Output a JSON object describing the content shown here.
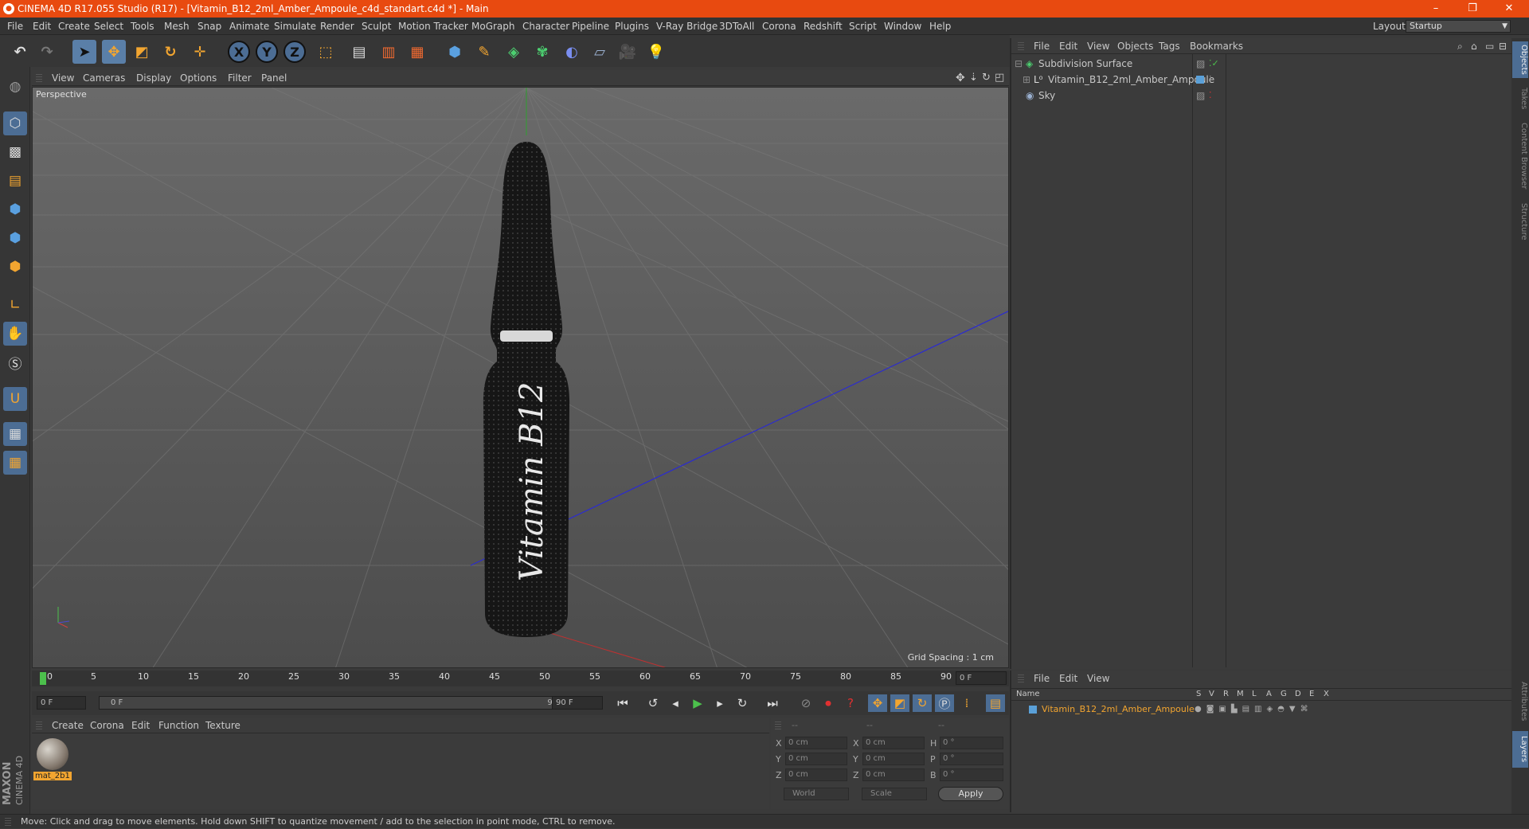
{
  "title": {
    "text": "CINEMA 4D R17.055 Studio (R17) - [Vitamin_B12_2ml_Amber_Ampoule_c4d_standart.c4d *] - Main",
    "minimize": "–",
    "restore": "❐",
    "close": "✕"
  },
  "menu": {
    "items": [
      "File",
      "Edit",
      "Create",
      "Select",
      "Tools",
      "Mesh",
      "Snap",
      "Animate",
      "Simulate",
      "Render",
      "Sculpt",
      "Motion Tracker",
      "MoGraph",
      "Character",
      "Pipeline",
      "Plugins",
      "V-Ray Bridge",
      "3DToAll",
      "Corona",
      "Redshift",
      "Script",
      "Window",
      "Help"
    ],
    "layout_label": "Layout:",
    "layout_value": "Startup"
  },
  "toolbar": {
    "axis_x": "X",
    "axis_y": "Y",
    "axis_z": "Z"
  },
  "viewport": {
    "menu": [
      "View",
      "Cameras",
      "Display",
      "Options",
      "Filter",
      "Panel"
    ],
    "label": "Perspective",
    "grid_spacing": "Grid Spacing : 1 cm",
    "bottle_text": "Vitamin B12"
  },
  "timeline": {
    "ticks": [
      "0",
      "5",
      "10",
      "15",
      "20",
      "25",
      "30",
      "35",
      "40",
      "45",
      "50",
      "55",
      "60",
      "65",
      "70",
      "75",
      "80",
      "85",
      "90"
    ],
    "current_frame": "0 F",
    "start_frame": "0 F",
    "range_start": "0 F",
    "range_end": "90 F",
    "end_frame": "90 F"
  },
  "material_manager": {
    "menu": [
      "Create",
      "Corona",
      "Edit",
      "Function",
      "Texture"
    ],
    "material_name": "mat_2b1"
  },
  "coordinates": {
    "headers": [
      "--",
      "--",
      "--"
    ],
    "rows": [
      {
        "a": "X",
        "av": "0 cm",
        "b": "X",
        "bv": "0 cm",
        "c": "H",
        "cv": "0 °"
      },
      {
        "a": "Y",
        "av": "0 cm",
        "b": "Y",
        "bv": "0 cm",
        "c": "P",
        "cv": "0 °"
      },
      {
        "a": "Z",
        "av": "0 cm",
        "b": "Z",
        "bv": "0 cm",
        "c": "B",
        "cv": "0 °"
      }
    ],
    "mode": "World",
    "size_mode": "Scale",
    "apply": "Apply"
  },
  "objects_panel": {
    "menu": [
      "File",
      "Edit",
      "View",
      "Objects",
      "Tags",
      "Bookmarks"
    ],
    "objects": [
      {
        "name": "Subdivision Surface",
        "indent": 0
      },
      {
        "name": "Vitamin_B12_2ml_Amber_Ampoule",
        "indent": 1
      },
      {
        "name": "Sky",
        "indent": 0
      }
    ]
  },
  "layers_panel": {
    "menu": [
      "File",
      "Edit",
      "View"
    ],
    "columns": [
      "Name",
      "S",
      "V",
      "R",
      "M",
      "L",
      "A",
      "G",
      "D",
      "E",
      "X"
    ],
    "layer_name": "Vitamin_B12_2ml_Amber_Ampoule"
  },
  "side_tabs": [
    "Objects",
    "Takes",
    "Content Browser",
    "Structure",
    "Attributes",
    "Layers"
  ],
  "logo": {
    "line1": "MAXON",
    "line2": "CINEMA 4D"
  },
  "status": "Move: Click and drag to move elements. Hold down SHIFT to quantize movement / add to the selection in point mode, CTRL to remove.",
  "colors": {
    "titlebar": "#e84a10",
    "accent": "#4c6d94",
    "material_label": "#f2a530",
    "layer_text": "#f2a530"
  }
}
